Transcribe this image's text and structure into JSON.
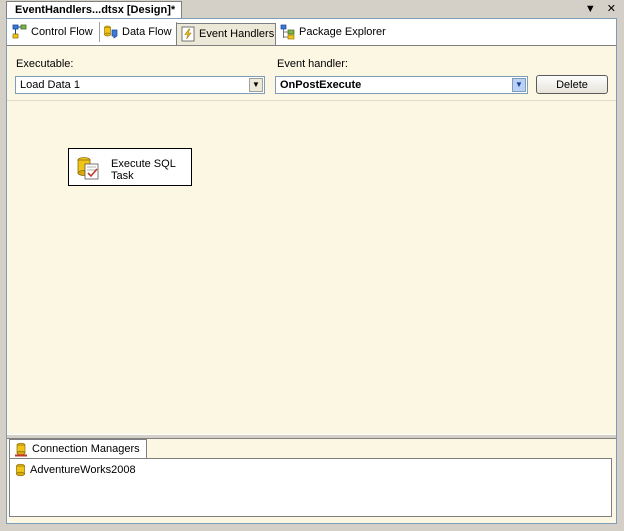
{
  "document": {
    "tab_title": "EventHandlers...dtsx [Design]*",
    "controls": {
      "dropdown": "▼",
      "close": "✕"
    }
  },
  "designer_tabs": [
    {
      "label": "Control Flow",
      "icon": "control-flow-icon",
      "active": false
    },
    {
      "label": "Data Flow",
      "icon": "data-flow-icon",
      "active": false
    },
    {
      "label": "Event Handlers",
      "icon": "event-handlers-icon",
      "active": true
    },
    {
      "label": "Package Explorer",
      "icon": "package-explorer-icon",
      "active": false
    }
  ],
  "executable": {
    "label": "Executable:",
    "value": "Load Data 1"
  },
  "event_handler": {
    "label": "Event handler:",
    "value": "OnPostExecute"
  },
  "delete_label": "Delete",
  "task": {
    "label": "Execute SQL Task"
  },
  "connection_managers": {
    "tab_label": "Connection Managers",
    "items": [
      {
        "label": "AdventureWorks2008",
        "icon": "connection-icon"
      }
    ]
  },
  "colors": {
    "surface": "#fcf7e3",
    "chrome": "#d4d0c8",
    "border_blue": "#7f9db9",
    "combo_arrow_blue": "#b9d1f5"
  }
}
